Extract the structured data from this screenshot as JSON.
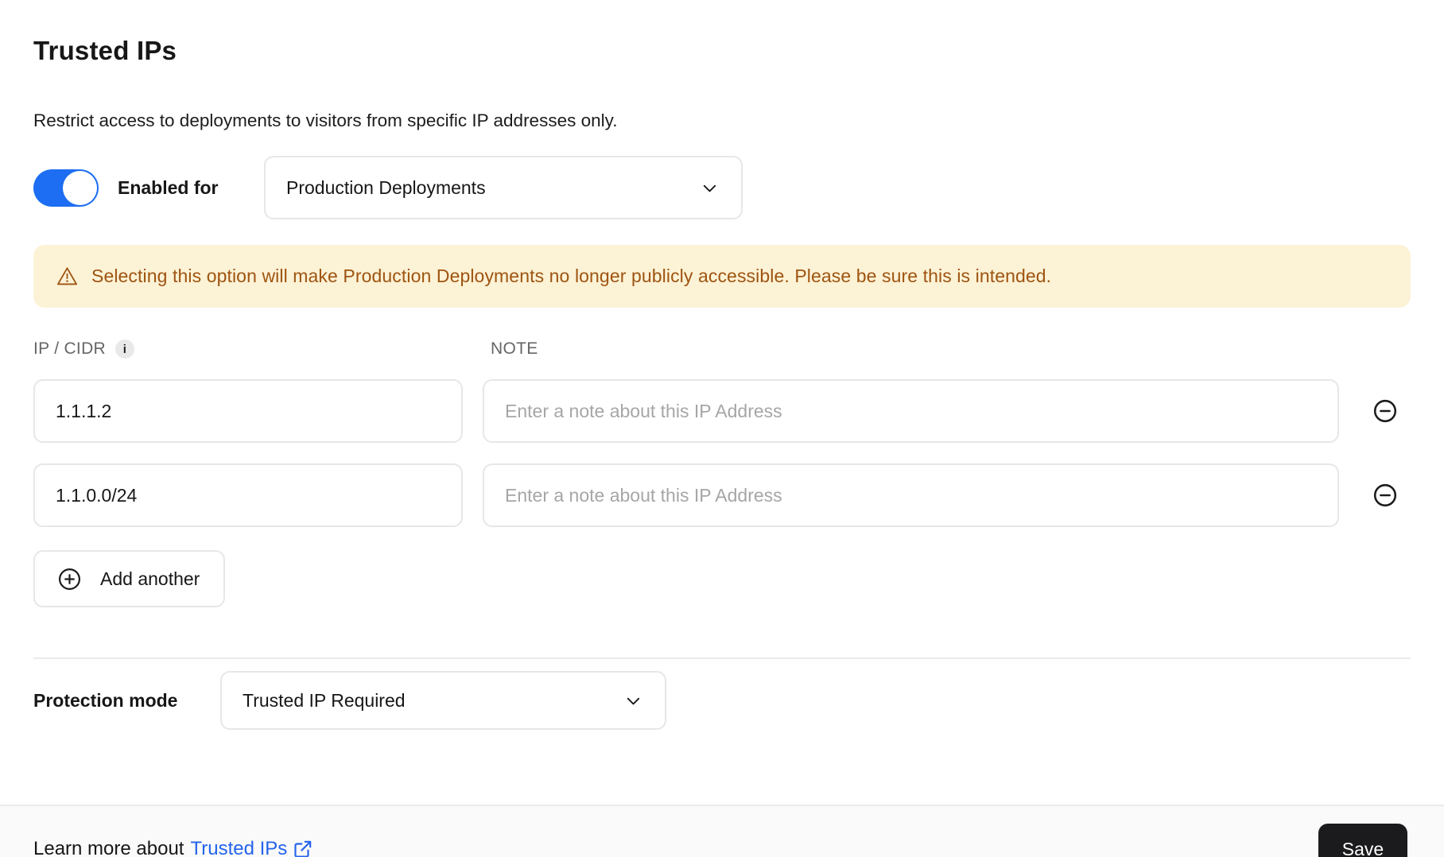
{
  "page": {
    "title": "Trusted IPs",
    "description": "Restrict access to deployments to visitors from specific IP addresses only."
  },
  "toggle": {
    "label": "Enabled for",
    "state": "on"
  },
  "enabled_for_select": {
    "value": "Production Deployments",
    "icon": "chevron-down-icon"
  },
  "warning": {
    "icon": "warning-triangle-icon",
    "text": "Selecting this option will make Production Deployments no longer publicly accessible. Please be sure this is intended."
  },
  "table": {
    "columns": [
      {
        "label": "IP / CIDR",
        "info_icon": "info-icon"
      },
      {
        "label": "NOTE"
      }
    ],
    "note_placeholder": "Enter a note about this IP Address",
    "rows": [
      {
        "ip": "1.1.1.2",
        "note": ""
      },
      {
        "ip": "1.1.0.0/24",
        "note": ""
      }
    ],
    "remove_icon": "minus-circle-icon",
    "add_button_label": "Add another",
    "add_button_icon": "plus-circle-icon"
  },
  "protection": {
    "label": "Protection mode",
    "value": "Trusted IP Required",
    "icon": "chevron-down-icon"
  },
  "footer": {
    "learn_prefix": "Learn more about",
    "link_label": "Trusted IPs",
    "link_icon": "external-link-icon",
    "save_label": "Save"
  },
  "colors": {
    "toggle_on": "#1d6ef2",
    "link_blue": "#2563eb",
    "warning_bg": "#fcf2d6",
    "warning_text": "#9e5410",
    "save_bg": "#1b1b1d"
  },
  "info_icon_glyph": "i"
}
